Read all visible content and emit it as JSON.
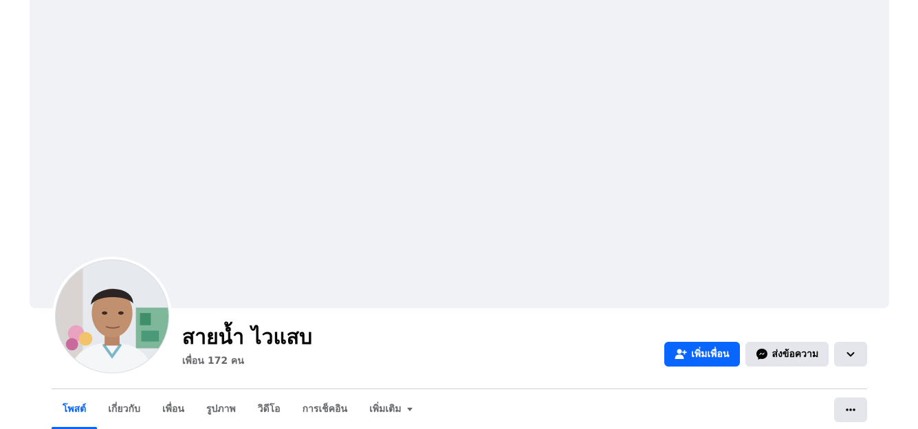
{
  "profile": {
    "name": "สายน้ำ ไวแสบ",
    "friends_count": "เพื่อน 172 คน"
  },
  "actions": {
    "add_friend_label": "เพิ่มเพื่อน",
    "message_label": "ส่งข้อความ",
    "add_friend_icon": "person-add-icon",
    "message_icon": "messenger-icon",
    "dropdown_icon": "chevron-down-icon",
    "more_icon": "more-horizontal-icon"
  },
  "tabs": [
    {
      "label": "โพสต์",
      "active": true
    },
    {
      "label": "เกี่ยวกับ",
      "active": false
    },
    {
      "label": "เพื่อน",
      "active": false
    },
    {
      "label": "รูปภาพ",
      "active": false
    },
    {
      "label": "วิดีโอ",
      "active": false
    },
    {
      "label": "การเช็คอิน",
      "active": false
    },
    {
      "label": "เพิ่มเติม",
      "active": false,
      "has_dropdown": true
    }
  ],
  "colors": {
    "accent": "#0866ff",
    "cover_background": "#f0f2f5",
    "secondary_button": "#e4e6eb",
    "muted_text": "#65676b"
  }
}
